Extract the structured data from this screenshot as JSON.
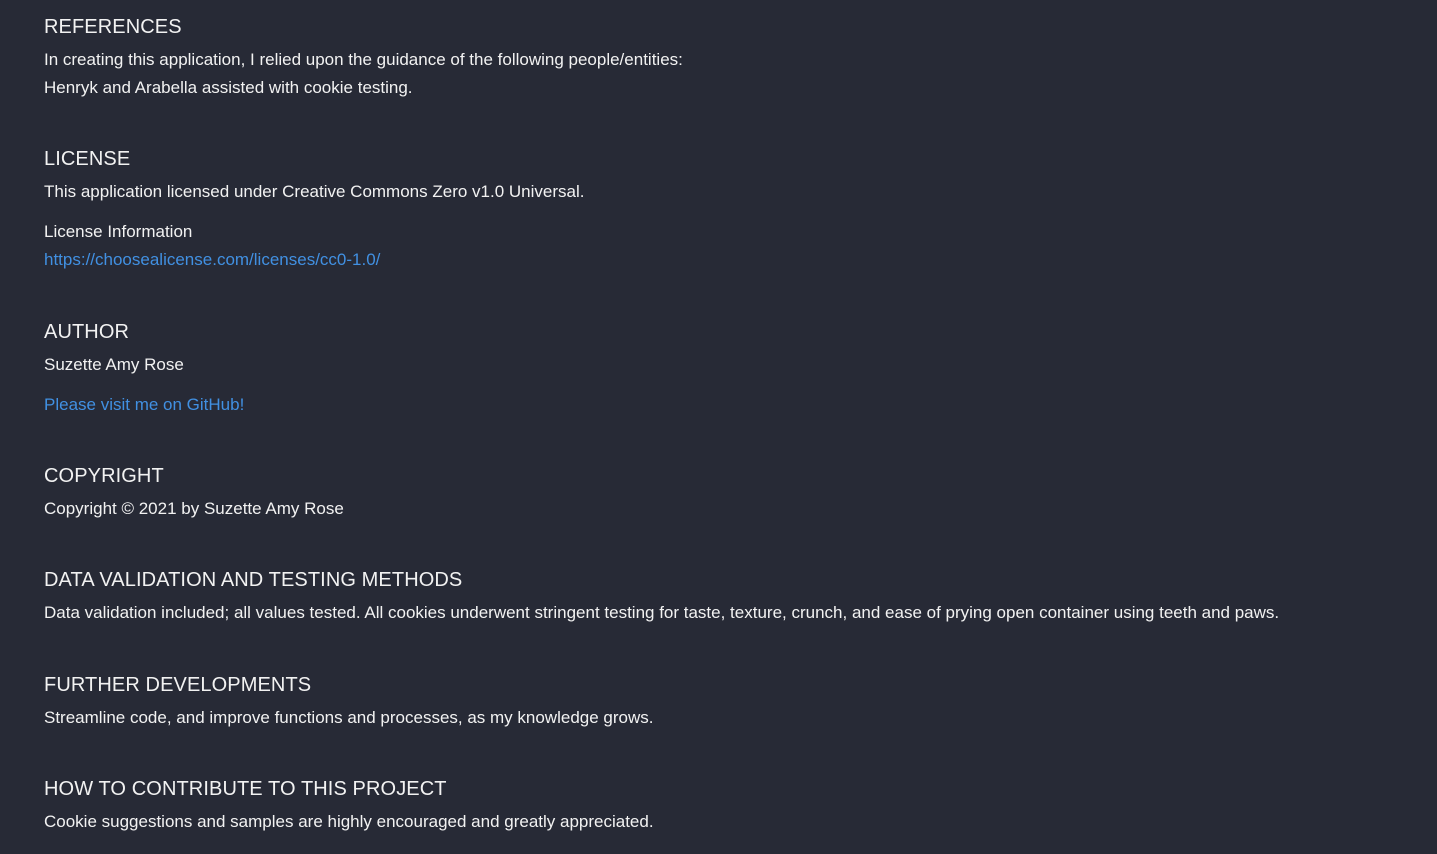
{
  "sections": {
    "references": {
      "heading": "REFERENCES",
      "lines": [
        "In creating this application, I relied upon the guidance of the following people/entities:",
        "Henryk and Arabella assisted with cookie testing."
      ]
    },
    "license": {
      "heading": "LICENSE",
      "text": "This application licensed under Creative Commons Zero v1.0 Universal.",
      "info_label": "License Information",
      "link_text": "https://choosealicense.com/licenses/cc0-1.0/"
    },
    "author": {
      "heading": "AUTHOR",
      "name": "Suzette Amy Rose",
      "link_text": "Please visit me on GitHub!"
    },
    "copyright": {
      "heading": "COPYRIGHT",
      "text": "Copyright © 2021 by Suzette Amy Rose"
    },
    "data_validation": {
      "heading": "DATA VALIDATION AND TESTING METHODS",
      "text": "Data validation included; all values tested. All cookies underwent stringent testing for taste, texture, crunch, and ease of prying open container using teeth and paws."
    },
    "further_developments": {
      "heading": "FURTHER DEVELOPMENTS",
      "text": "Streamline code, and improve functions and processes, as my knowledge grows."
    },
    "contribute": {
      "heading": "HOW TO CONTRIBUTE TO THIS PROJECT",
      "text": "Cookie suggestions and samples are highly encouraged and greatly appreciated."
    }
  },
  "colors": {
    "background": "#272a36",
    "text": "#f2f2f2",
    "link": "#4190e2"
  }
}
